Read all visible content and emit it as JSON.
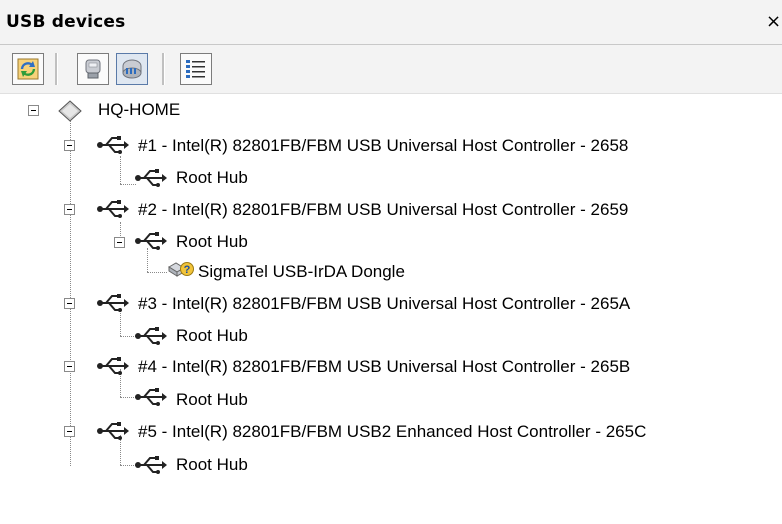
{
  "window": {
    "title": "USB devices",
    "close_symbol": "×"
  },
  "toolbar": {
    "buttons": [
      {
        "name": "refresh-button",
        "icon": "refresh-icon"
      },
      {
        "name": "show-devices-button",
        "icon": "device-icon"
      },
      {
        "name": "show-hubs-button",
        "icon": "hub-icon"
      },
      {
        "name": "details-view-button",
        "icon": "list-icon"
      }
    ]
  },
  "tree": {
    "root": {
      "label": "HQ-HOME",
      "icon": "computer-diamond-icon"
    },
    "controllers": [
      {
        "label": "#1 - Intel(R) 82801FB/FBM USB Universal Host Controller - 2658",
        "hub": "Root Hub"
      },
      {
        "label": "#2 - Intel(R) 82801FB/FBM USB Universal Host Controller - 2659",
        "hub": "Root Hub",
        "device": "SigmaTel USB-IrDA Dongle"
      },
      {
        "label": "#3 - Intel(R) 82801FB/FBM USB Universal Host Controller - 265A",
        "hub": "Root Hub"
      },
      {
        "label": "#4 - Intel(R) 82801FB/FBM USB Universal Host Controller - 265B",
        "hub": "Root Hub"
      },
      {
        "label": "#5 - Intel(R) 82801FB/FBM USB2 Enhanced Host Controller - 265C",
        "hub": "Root Hub"
      }
    ]
  }
}
